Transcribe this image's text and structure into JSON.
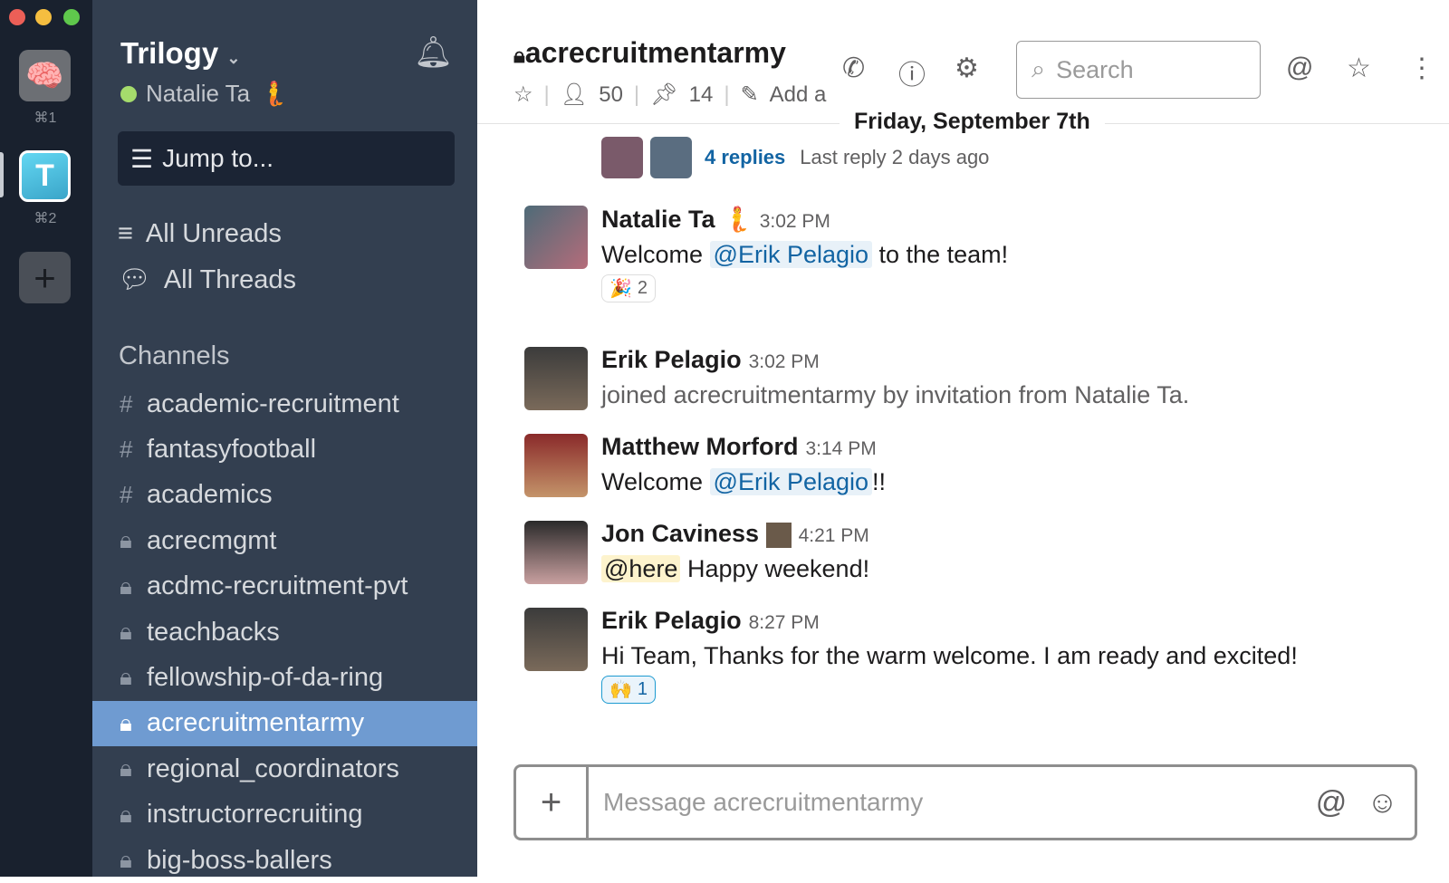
{
  "window": {
    "controls": [
      "close",
      "minimize",
      "maximize"
    ]
  },
  "workspaces": [
    {
      "icon": "brain-icon",
      "shortcut": "⌘1"
    },
    {
      "icon": "trilogy-diamond-icon",
      "letter": "T",
      "shortcut": "⌘2"
    }
  ],
  "sidebar": {
    "team": "Trilogy",
    "user": "Natalie Ta",
    "status_color": "#a5dc6c",
    "jump": "Jump to...",
    "nav": [
      {
        "label": "All Unreads",
        "icon": "unreads-icon"
      },
      {
        "label": "All Threads",
        "icon": "threads-icon"
      }
    ],
    "channels_header": "Channels",
    "channels": [
      {
        "name": "academic-recruitment",
        "private": false
      },
      {
        "name": "fantasyfootball",
        "private": false
      },
      {
        "name": "academics",
        "private": false
      },
      {
        "name": "acrecmgmt",
        "private": true
      },
      {
        "name": "acdmc-recruitment-pvt",
        "private": true
      },
      {
        "name": "teachbacks",
        "private": true
      },
      {
        "name": "fellowship-of-da-ring",
        "private": true
      },
      {
        "name": "acrecruitmentarmy",
        "private": true,
        "active": true
      },
      {
        "name": "regional_coordinators",
        "private": true
      },
      {
        "name": "instructorrecruiting",
        "private": true
      },
      {
        "name": "big-boss-ballers",
        "private": true
      }
    ]
  },
  "header": {
    "channel": "acrecruitmentarmy",
    "members": "50",
    "pins": "14",
    "add_topic": "Add a",
    "search_placeholder": "Search"
  },
  "date_divider": "Friday, September 7th",
  "thread": {
    "replies": "4 replies",
    "last_reply": "Last reply 2 days ago"
  },
  "messages": [
    {
      "author": "Natalie Ta",
      "time": "3:02 PM",
      "pre": "Welcome ",
      "mention": "@Erik Pelagio",
      "post": " to the team!",
      "reaction": {
        "emoji": "🎉",
        "count": "2"
      }
    },
    {
      "author": "Erik Pelagio",
      "time": "3:02 PM",
      "text": "joined acrecruitmentarmy by invitation from Natalie Ta."
    },
    {
      "author": "Matthew Morford",
      "time": "3:14 PM",
      "pre": "Welcome ",
      "mention": "@Erik Pelagio",
      "post": "!!"
    },
    {
      "author": "Jon Caviness",
      "time": "4:21 PM",
      "mention": "@here",
      "post": " Happy weekend!"
    },
    {
      "author": "Erik Pelagio",
      "time": "8:27 PM",
      "text": "Hi Team, Thanks for the warm welcome. I am ready and excited!",
      "reaction": {
        "emoji": "🙌",
        "count": "1"
      }
    }
  ],
  "composer": {
    "placeholder": "Message acrecruitmentarmy"
  }
}
